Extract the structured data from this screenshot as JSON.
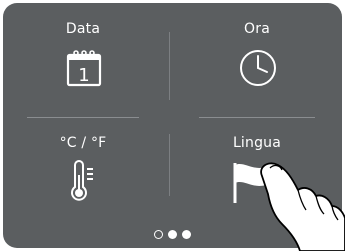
{
  "tiles": {
    "date": {
      "label": "Data",
      "calendar_day": "1"
    },
    "time": {
      "label": "Ora"
    },
    "units": {
      "label": "°C / °F"
    },
    "language": {
      "label": "Lingua"
    }
  },
  "pager": {
    "total_pages": 3,
    "current_page": 2
  },
  "colors": {
    "panel": "#5b5e60",
    "foreground": "#ffffff"
  }
}
